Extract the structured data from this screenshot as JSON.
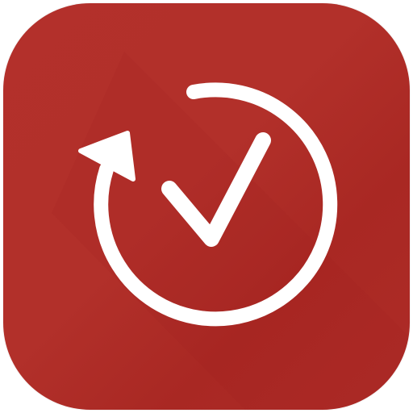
{
  "app_icon": {
    "icon_name": "timer-checkmark-app-icon",
    "background_color": "#b3302b",
    "glyph_color": "#ffffff",
    "glyph_parts": [
      "refresh-arrow-icon",
      "checkmark-icon"
    ]
  }
}
